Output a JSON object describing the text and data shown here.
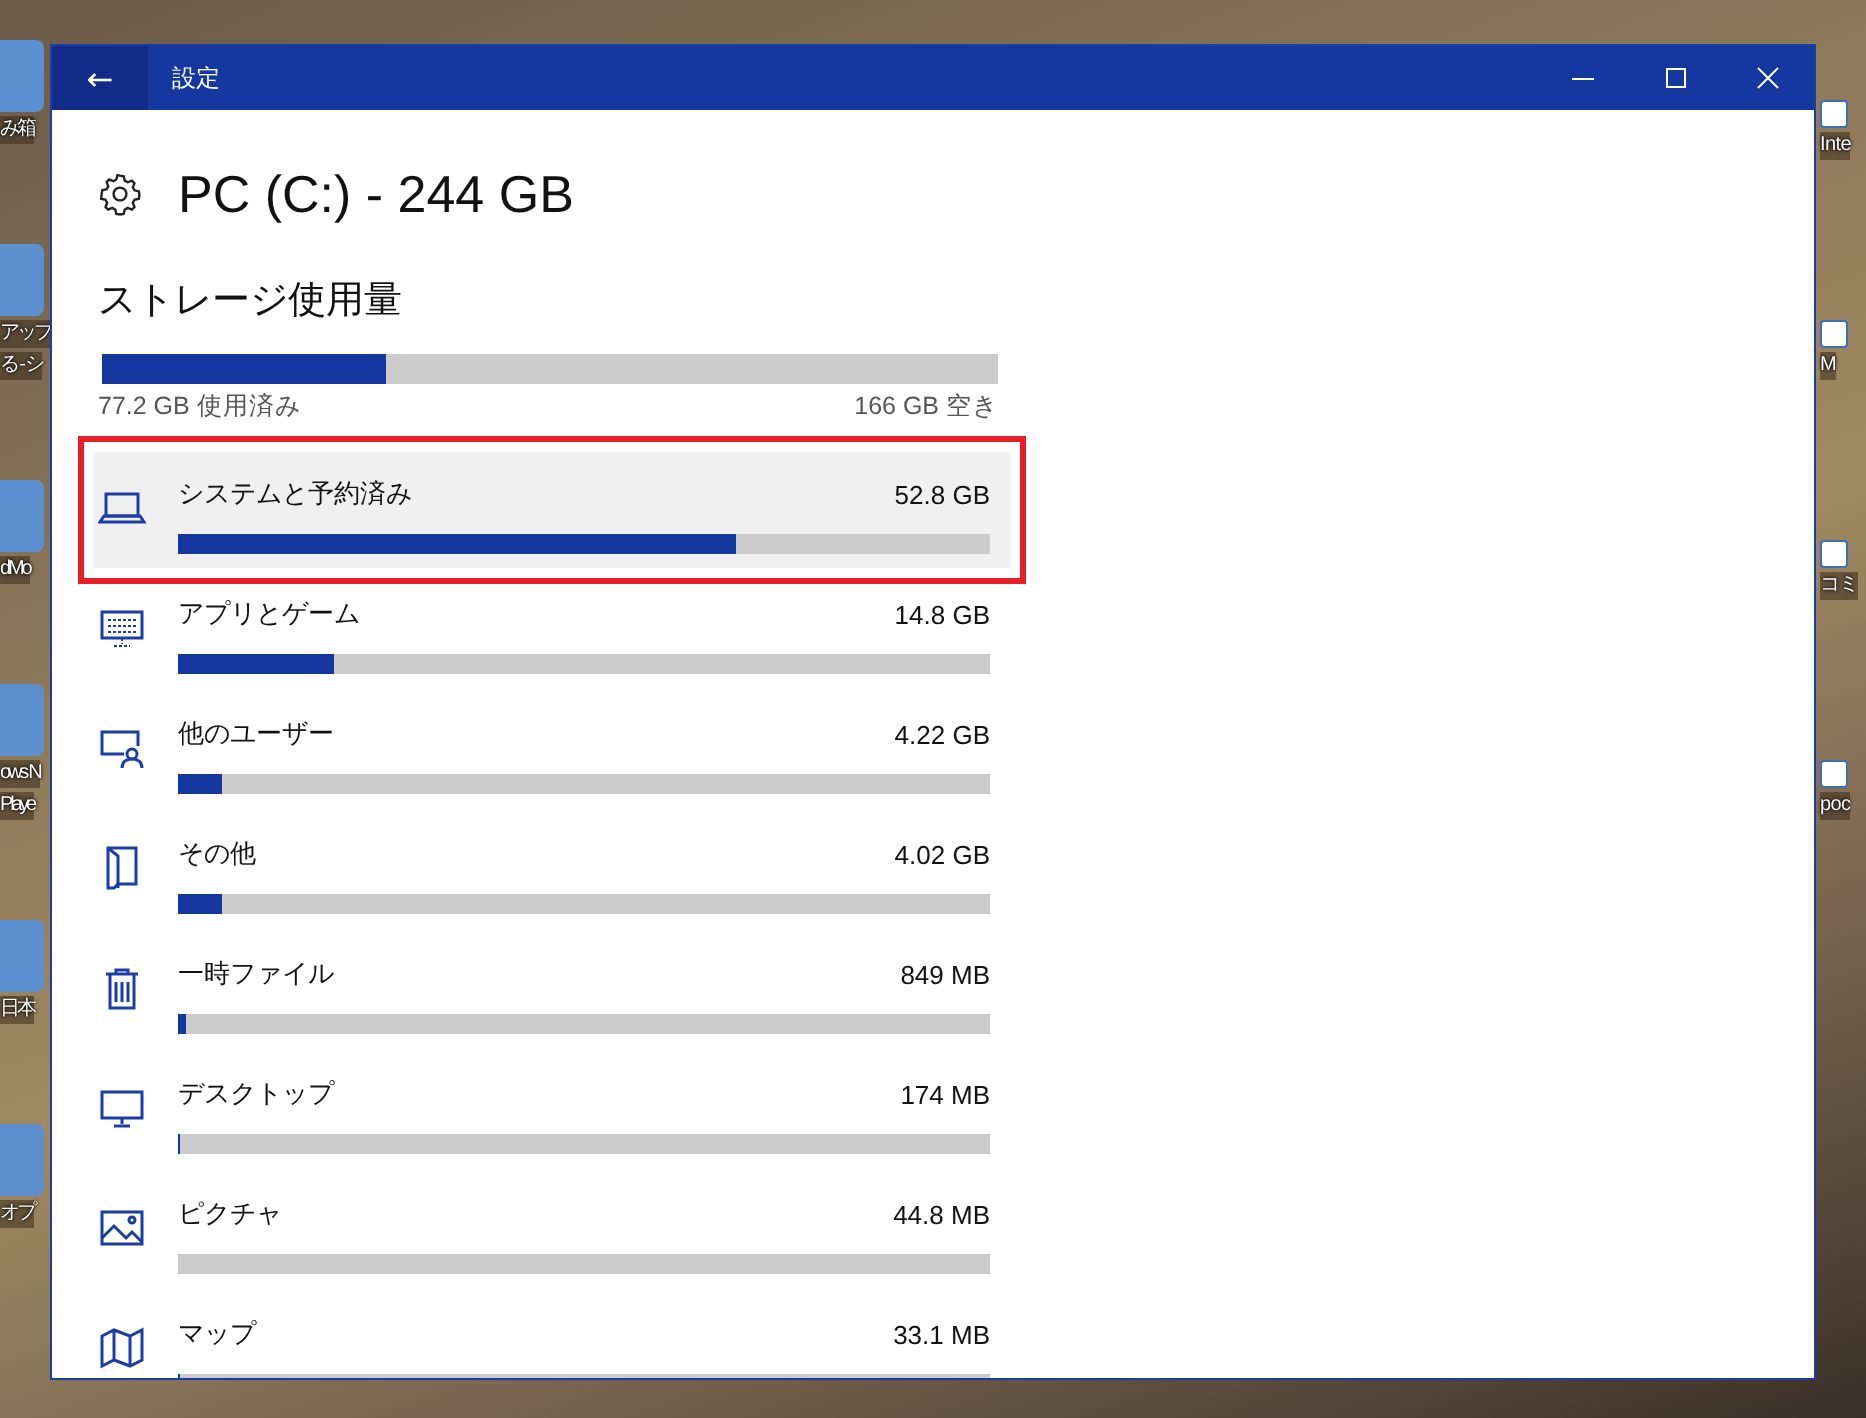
{
  "desktop": {
    "left_icons": [
      {
        "lines": [
          "み箱"
        ]
      },
      {
        "lines": [
          "アップ",
          "る - シ"
        ]
      },
      {
        "lines": [
          "dMo"
        ]
      },
      {
        "lines": [
          "ows N",
          "Playe"
        ]
      },
      {
        "lines": [
          "日本"
        ]
      },
      {
        "lines": [
          "オプ"
        ]
      }
    ],
    "right_icons": [
      {
        "lines": [
          "Inte"
        ]
      },
      {
        "lines": [
          "M"
        ]
      },
      {
        "lines": [
          "コミ"
        ]
      },
      {
        "lines": [
          "poc"
        ]
      }
    ]
  },
  "window": {
    "title": "設定",
    "back": "←"
  },
  "page": {
    "title": "PC (C:) - 244 GB",
    "section": "ストレージ使用量",
    "total": {
      "level": 0.316,
      "used": "77.2 GB 使用済み",
      "free": "166 GB 空き"
    }
  },
  "items": [
    {
      "kind": "system",
      "name": "システムと予約済み",
      "size": "52.8 GB",
      "level": 0.686,
      "highlighted": true
    },
    {
      "kind": "apps",
      "name": "アプリとゲーム",
      "size": "14.8 GB",
      "level": 0.193,
      "highlighted": false
    },
    {
      "kind": "users",
      "name": "他のユーザー",
      "size": "4.22 GB",
      "level": 0.055,
      "highlighted": false
    },
    {
      "kind": "other",
      "name": "その他",
      "size": "4.02 GB",
      "level": 0.053,
      "highlighted": false
    },
    {
      "kind": "temp",
      "name": "一時ファイル",
      "size": "849 MB",
      "level": 0.01,
      "highlighted": false
    },
    {
      "kind": "desktop",
      "name": "デスクトップ",
      "size": "174 MB",
      "level": 0.003,
      "highlighted": false
    },
    {
      "kind": "pictures",
      "name": "ピクチャ",
      "size": "44.8 MB",
      "level": 0,
      "highlighted": false
    },
    {
      "kind": "maps",
      "name": "マップ",
      "size": "33.1 MB",
      "level": 0.002,
      "highlighted": false
    }
  ]
}
